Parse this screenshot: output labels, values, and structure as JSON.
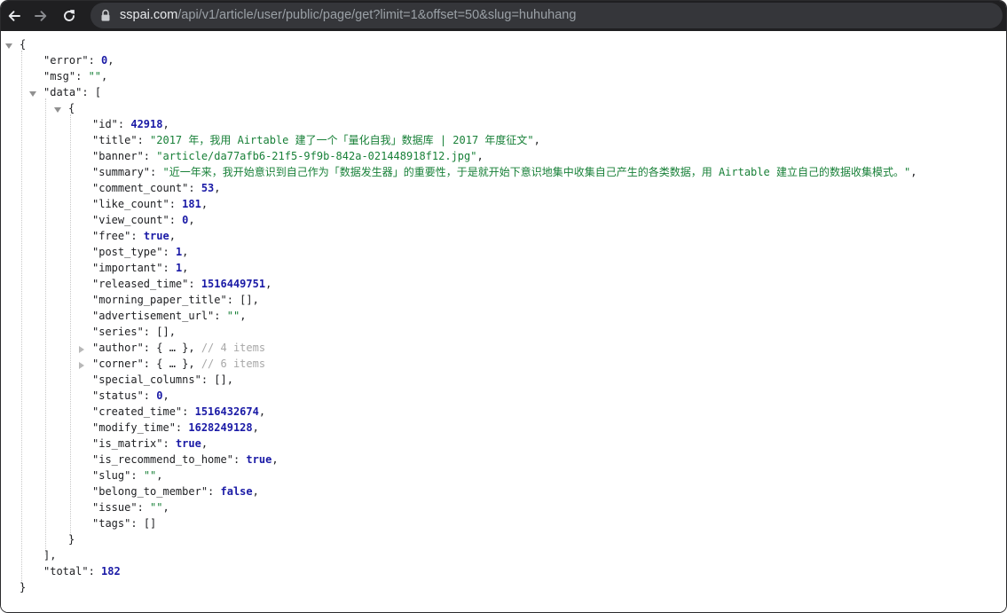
{
  "browser": {
    "url_host": "sspai.com",
    "url_path": "/api/v1/article/user/public/page/get?limit=1&offset=50&slug=huhuhang"
  },
  "json": {
    "open_brace": "{",
    "close_brace": "}",
    "error_key": "\"error\"",
    "error_value": "0",
    "msg_key": "\"msg\"",
    "msg_value": "\"\"",
    "data_key": "\"data\"",
    "data_open": "[",
    "data_close": "],",
    "item_open": "{",
    "item_close": "}",
    "total_key": "\"total\"",
    "total_value": "182",
    "fields": {
      "id": {
        "key": "\"id\"",
        "value": "42918"
      },
      "title": {
        "key": "\"title\"",
        "value": "\"2017 年，我用 Airtable 建了一个「量化自我」数据库 | 2017 年度征文\""
      },
      "banner": {
        "key": "\"banner\"",
        "value": "\"article/da77afb6-21f5-9f9b-842a-021448918f12.jpg\""
      },
      "summary": {
        "key": "\"summary\"",
        "value": "\"近一年来，我开始意识到自己作为「数据发生器」的重要性，于是就开始下意识地集中收集自己产生的各类数据，用 Airtable 建立自己的数据收集模式。\""
      },
      "comment_count": {
        "key": "\"comment_count\"",
        "value": "53"
      },
      "like_count": {
        "key": "\"like_count\"",
        "value": "181"
      },
      "view_count": {
        "key": "\"view_count\"",
        "value": "0"
      },
      "free": {
        "key": "\"free\"",
        "value": "true"
      },
      "post_type": {
        "key": "\"post_type\"",
        "value": "1"
      },
      "important": {
        "key": "\"important\"",
        "value": "1"
      },
      "released_time": {
        "key": "\"released_time\"",
        "value": "1516449751"
      },
      "morning_paper_title": {
        "key": "\"morning_paper_title\"",
        "value": "[]"
      },
      "advertisement_url": {
        "key": "\"advertisement_url\"",
        "value": "\"\""
      },
      "series": {
        "key": "\"series\"",
        "value": "[]"
      },
      "author": {
        "key": "\"author\"",
        "value": "{ … }",
        "comment": "// 4 items"
      },
      "corner": {
        "key": "\"corner\"",
        "value": "{ … }",
        "comment": "// 6 items"
      },
      "special_columns": {
        "key": "\"special_columns\"",
        "value": "[]"
      },
      "status": {
        "key": "\"status\"",
        "value": "0"
      },
      "created_time": {
        "key": "\"created_time\"",
        "value": "1516432674"
      },
      "modify_time": {
        "key": "\"modify_time\"",
        "value": "1628249128"
      },
      "is_matrix": {
        "key": "\"is_matrix\"",
        "value": "true"
      },
      "is_recommend_to_home": {
        "key": "\"is_recommend_to_home\"",
        "value": "true"
      },
      "slug": {
        "key": "\"slug\"",
        "value": "\"\""
      },
      "belong_to_member": {
        "key": "\"belong_to_member\"",
        "value": "false"
      },
      "issue": {
        "key": "\"issue\"",
        "value": "\"\""
      },
      "tags": {
        "key": "\"tags\"",
        "value": "[]"
      }
    }
  },
  "colors": {
    "toolbar": "#1f1f21",
    "omnibox": "#35363a",
    "number": "#1a1aa6",
    "string": "#188038",
    "comment": "#a8a8a8"
  },
  "icons": {
    "back": "back-arrow-icon",
    "forward": "forward-arrow-icon",
    "reload": "reload-icon",
    "lock": "lock-icon",
    "expanded": "triangle-down-icon",
    "collapsed": "triangle-right-icon"
  }
}
